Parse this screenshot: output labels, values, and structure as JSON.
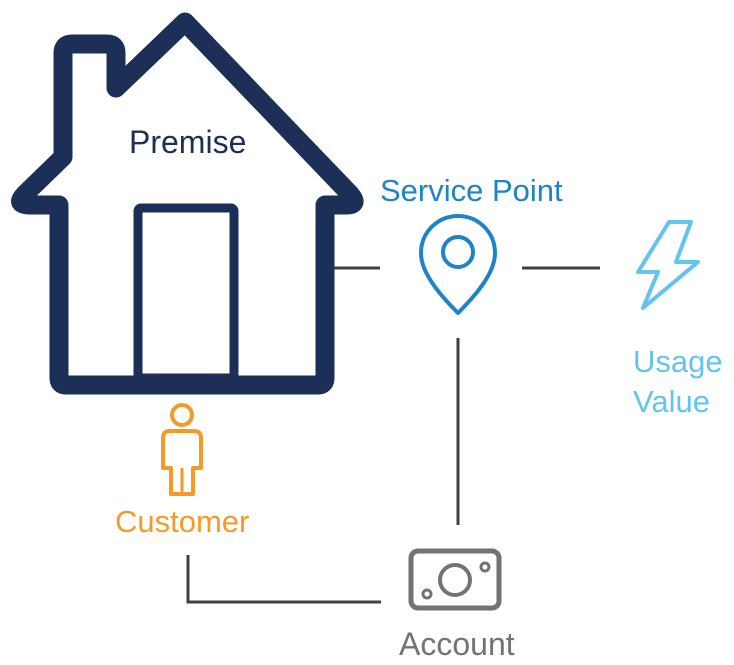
{
  "nodes": {
    "premise": {
      "label": "Premise",
      "icon": "house-icon",
      "color": "#1b2f57"
    },
    "service_point": {
      "label": "Service Point",
      "icon": "map-pin-icon",
      "color": "#1f83c8"
    },
    "usage_value": {
      "line1": "Usage",
      "line2": "Value",
      "icon": "lightning-bolt-icon",
      "color": "#62c4ef"
    },
    "customer": {
      "label": "Customer",
      "icon": "person-icon",
      "color": "#f39a27"
    },
    "account": {
      "label": "Account",
      "icon": "money-bill-icon",
      "color": "#737373"
    }
  },
  "connector_color": "#404040"
}
